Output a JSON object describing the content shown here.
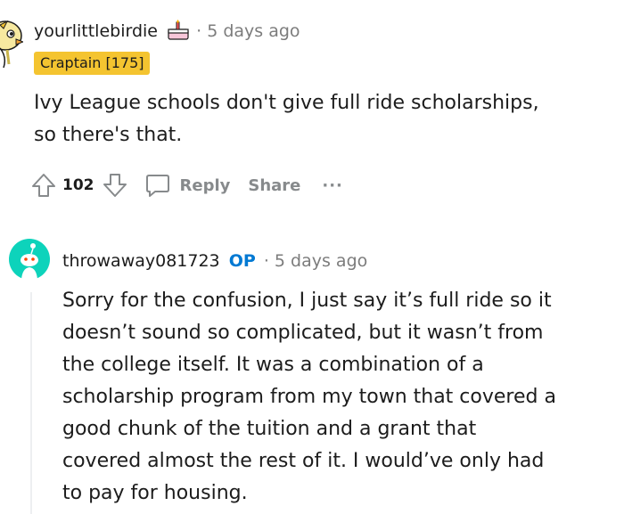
{
  "comments": [
    {
      "username": "yourlittlebirdie",
      "separator": "·",
      "timestamp": "5 days ago",
      "flair": "Craptain [175]",
      "body_lines": [
        "Ivy League schools don't give full ride scholarships,",
        "so there's that."
      ],
      "votes": "102",
      "actions": {
        "reply": "Reply",
        "share": "Share",
        "more": "···"
      },
      "icons": {
        "avatar": "bird-avatar-icon",
        "award": "cake-award-icon",
        "upvote": "upvote-arrow-icon",
        "downvote": "downvote-arrow-icon",
        "comment": "comment-bubble-icon"
      }
    },
    {
      "username": "throwaway081723",
      "op_badge": "OP",
      "separator": "·",
      "timestamp": "5 days ago",
      "body_lines": [
        "Sorry for the confusion, I just say it’s full ride so it",
        "doesn’t sound so complicated, but it wasn’t from",
        "the college itself. It was a combination of a",
        "scholarship program from my town that covered a",
        "good chunk of the tuition and a grant that",
        "covered almost the rest of it. I would’ve only had",
        "to pay for housing."
      ],
      "icons": {
        "avatar": "snoo-avatar-icon"
      }
    }
  ],
  "colors": {
    "flair_bg": "#f4c430",
    "op_blue": "#0079d3",
    "muted_gray": "#7c7c7c",
    "action_gray": "#878a8c",
    "avatar2_bg": "#0dd3bb"
  }
}
